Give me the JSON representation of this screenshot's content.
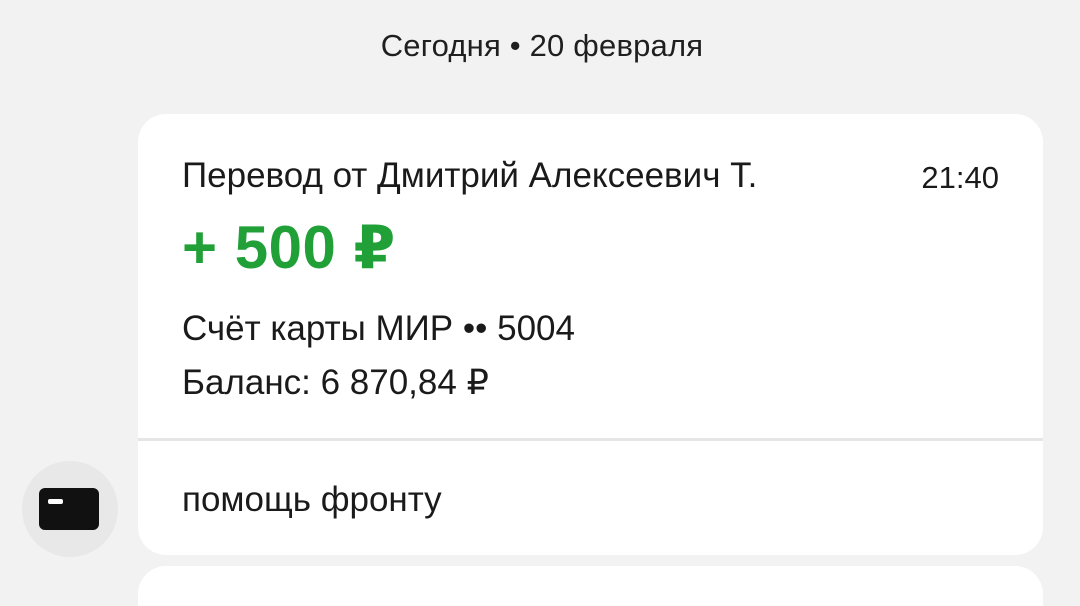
{
  "chat": {
    "date_separator": "Сегодня • 20 февраля"
  },
  "message": {
    "title": "Перевод от Дмитрий Алексеевич Т.",
    "time": "21:40",
    "amount": "+ 500 ₽",
    "account": "Счёт карты МИР •• 5004",
    "balance": "Баланс: 6 870,84 ₽",
    "note": "помощь фронту"
  },
  "sender": {
    "icon": "bank-card-icon"
  },
  "colors": {
    "background": "#f2f2f2",
    "card": "#ffffff",
    "amount": "#21a038",
    "text": "#1a1a1a"
  }
}
